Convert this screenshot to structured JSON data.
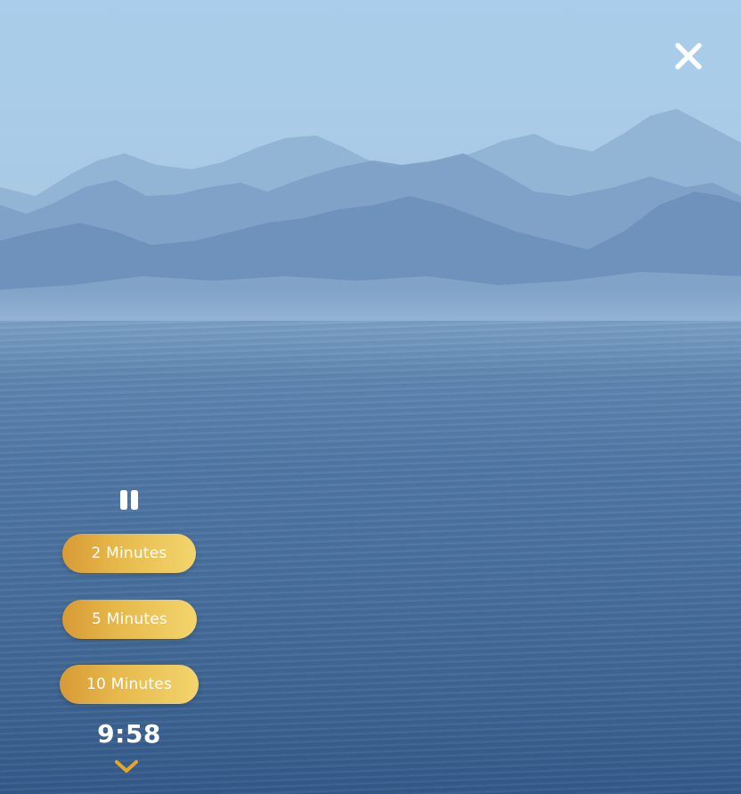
{
  "screen": {
    "background_scene": "mountain-lake-background"
  },
  "header": {
    "close_icon": "close-icon"
  },
  "player": {
    "pause_icon": "pause-icon",
    "durations": [
      {
        "label": "2 Minutes"
      },
      {
        "label": "5 Minutes"
      },
      {
        "label": "10 Minutes"
      }
    ],
    "remaining_time": "9:58",
    "collapse_icon": "chevron-down-icon"
  },
  "colors": {
    "button_gradient_start": "#d89a35",
    "button_gradient_end": "#f3d56c",
    "button_text": "#ffffff",
    "chevron": "#e6a623",
    "icon_white": "#ffffff"
  }
}
